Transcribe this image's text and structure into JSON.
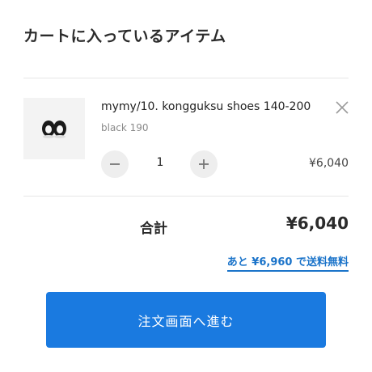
{
  "cart": {
    "title": "カートに入っているアイテム"
  },
  "item": {
    "name": "mymy/10. kongguksu shoes 140-200",
    "variant": "black 190",
    "quantity": "1",
    "price": "¥6,040",
    "remove_icon": "close-icon",
    "decrement_icon": "minus-icon",
    "increment_icon": "plus-icon"
  },
  "summary": {
    "total_label": "合計",
    "total_value": "¥6,040",
    "shipping_note": "あと ¥6,960 で送料無料"
  },
  "checkout": {
    "label": "注文画面へ進む"
  },
  "colors": {
    "accent": "#1a7ae0",
    "link": "#1a73c9"
  }
}
